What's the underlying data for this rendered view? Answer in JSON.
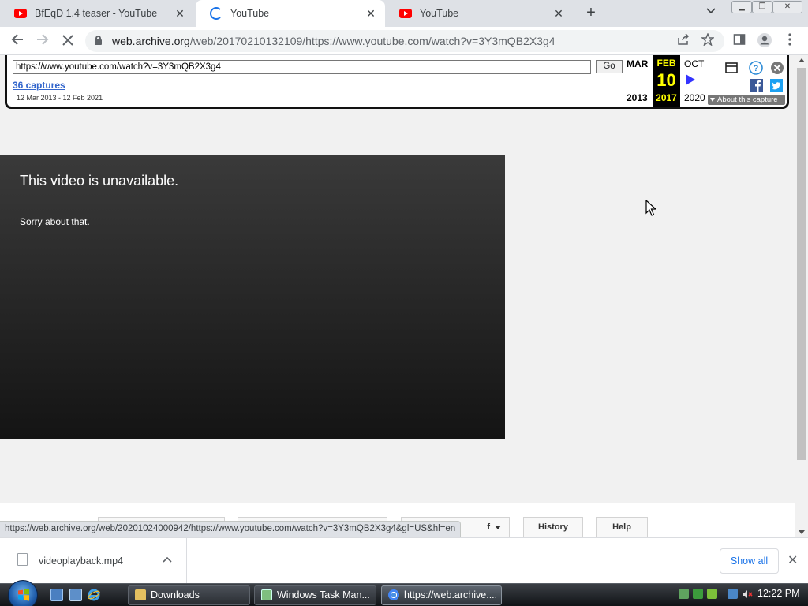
{
  "tabs": [
    {
      "title": "BfEqD 1.4 teaser - YouTube",
      "icon": "youtube-icon"
    },
    {
      "title": "YouTube",
      "icon": "loading-spinner-icon",
      "active": true
    },
    {
      "title": "YouTube",
      "icon": "youtube-icon"
    }
  ],
  "toolbar": {
    "url_host": "web.archive.org",
    "url_path": "/web/20170210132109/https://www.youtube.com/watch?v=3Y3mQB2X3g4"
  },
  "wayback": {
    "url_value": "https://www.youtube.com/watch?v=3Y3mQB2X3g4",
    "go_label": "Go",
    "captures_label": "36 captures",
    "range_label": "12 Mar 2013 - 12 Feb 2021",
    "prev_month": "MAR",
    "prev_year": "2013",
    "current_month": "FEB",
    "current_day": "10",
    "current_year": "2017",
    "next_month": "OCT",
    "next_year": "2020",
    "about_label": "About this capture"
  },
  "error": {
    "title": "This video is unavailable.",
    "subtitle": "Sorry about that."
  },
  "footer": {
    "buttons_partial": [
      "f",
      "History",
      "Help"
    ]
  },
  "status_url": "https://web.archive.org/web/20201024000942/https://www.youtube.com/watch?v=3Y3mQB2X3g4&gl=US&hl=en",
  "downloads": {
    "file_name": "videoplayback.mp4",
    "show_all_label": "Show all"
  },
  "taskbar": {
    "tasks": [
      {
        "label": "Downloads",
        "icon": "folder-icon"
      },
      {
        "label": "Windows Task Man...",
        "icon": "task-manager-icon"
      },
      {
        "label": "https://web.archive....",
        "icon": "chrome-icon",
        "active": true
      }
    ],
    "clock": "12:22 PM"
  },
  "colors": {
    "youtube_red": "#ff0000",
    "wayback_link": "#3366cc",
    "wayback_current_bg": "#000000",
    "wayback_current_text": "#ffff00",
    "chrome_accent": "#1a73e8"
  }
}
